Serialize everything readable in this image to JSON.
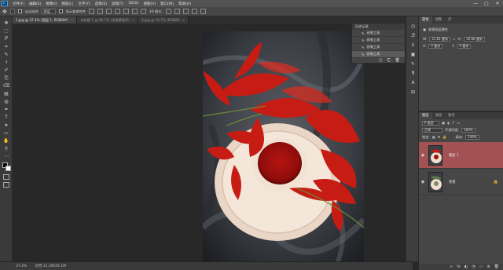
{
  "menubar": {
    "logo": "Ps",
    "items": [
      "文件(F)",
      "编辑(E)",
      "图像(I)",
      "图层(L)",
      "文字(Y)",
      "选择(S)",
      "滤镜(T)",
      "3D(D)",
      "视图(V)",
      "窗口(W)",
      "帮助(H)"
    ],
    "minimize": "—",
    "maximize": "▢",
    "close": "✕"
  },
  "options": {
    "auto_select_label": "自动选择",
    "target": "图层",
    "show_transform_label": "显示变换控件",
    "mode_3d_label": "3D 模式:"
  },
  "tabs": [
    {
      "label": "1.jpg @ 37.4% (图层 1, RGB/8#)",
      "close": "×"
    },
    {
      "label": "未标题-1 @ 66.7% (快速蒙版/8)",
      "close": "×"
    },
    {
      "label": "2.jpg @ 16.7% (RGB/8)",
      "close": "×"
    }
  ],
  "toolbar": {
    "tools": [
      "✥",
      "⬚",
      "ᑭ",
      "⌗",
      "✎",
      "⚕",
      "✐",
      "⎘",
      "⌫",
      "▤",
      "◍",
      "✒",
      "T",
      "➤",
      "▭",
      "✋",
      "⚲",
      "⋯"
    ]
  },
  "history": {
    "title": "历史记录",
    "items": [
      "画笔工具",
      "画笔工具",
      "画笔工具",
      "画笔工具"
    ],
    "selected_index": 3,
    "footer_icons": [
      "◰",
      "⎗",
      "🗑"
    ]
  },
  "right_strip": {
    "icons": [
      "◷",
      "♬",
      "ℹ",
      "▣",
      "✎",
      "¶",
      "A",
      "⊞"
    ]
  },
  "properties": {
    "tabs": [
      "属性",
      "调整",
      "库"
    ],
    "section": "像素图层属性",
    "w_label": "W:",
    "w_value": "21.81 厘米",
    "link_icon": "∞",
    "h_label": "H:",
    "h_value": "32.66 厘米",
    "x_label": "X:",
    "x_value": "0 厘米",
    "y_label": "Y:",
    "y_value": "0 厘米"
  },
  "layers": {
    "tabs": [
      "图层",
      "通道",
      "路径"
    ],
    "kind_label": "P 类型",
    "blend_mode": "正常",
    "opacity_label": "不透明度:",
    "opacity_value": "100%",
    "lock_label": "锁定:",
    "fill_label": "填充:",
    "fill_value": "100%",
    "items": [
      {
        "name": "图层 1",
        "eye": "◉",
        "lock": ""
      },
      {
        "name": "背景",
        "eye": "◉",
        "lock": "🔒"
      }
    ],
    "footer_icons": [
      "∞",
      "fx",
      "◐",
      "◔",
      "▭",
      "⊕",
      "🗑"
    ],
    "selected_color": "#a25252"
  },
  "status": {
    "zoom": "37.4%",
    "doc_info": "文档:11.5M/26.1M"
  },
  "colors": {
    "foreground": "#000000",
    "background": "#ffffff"
  }
}
